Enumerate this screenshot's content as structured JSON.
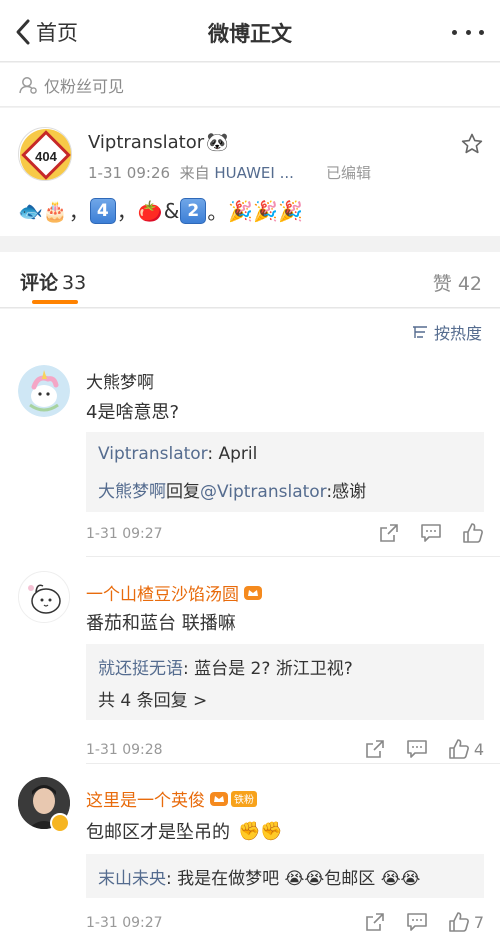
{
  "nav": {
    "back_label": "首页",
    "title": "微博正文"
  },
  "visibility": {
    "label": "仅粉丝可见"
  },
  "post": {
    "author": "Viptranslator",
    "avatar_text": "404",
    "time": "1-31 09:26",
    "source_prefix": "来自",
    "source_device": "HUAWEI ...",
    "edited": "已编辑",
    "content": {
      "emoji1": "🐟🎂",
      "sep1": "，",
      "key1": "4",
      "sep2": "，",
      "emoji2": "🍅",
      "amp": "&",
      "key2": "2",
      "end": "。",
      "emoji3": "🎉🎉🎉"
    }
  },
  "comments_header": {
    "tab_label": "评论",
    "tab_count": "33",
    "likes_label": "赞",
    "likes_count": "42"
  },
  "sort": {
    "label": "按热度"
  },
  "comments": [
    {
      "name": "大熊梦啊",
      "text": "4是啥意思?",
      "reply1_user": "Viptranslator",
      "reply1_text": ": April",
      "reply2_user": "大熊梦啊",
      "reply2_mid": "回复",
      "reply2_mention": "@Viptranslator",
      "reply2_text": ":感谢",
      "time": "1-31 09:27",
      "likes": ""
    },
    {
      "name": "一个山楂豆沙馅汤圆",
      "text": "番茄和蓝台 联播嘛",
      "reply1_user": "就还挺无语",
      "reply1_text": ": 蓝台是 2? 浙江卫视?",
      "more_replies": "共 4 条回复 >",
      "time": "1-31 09:28",
      "likes": "4"
    },
    {
      "name": "这里是一个英俊",
      "fan_badge": "铁粉",
      "text": "包邮区才是坠吊的",
      "text_emoji": "✊✊",
      "reply1_user": "末山未央",
      "reply1_text": ": 我是在做梦吧",
      "reply1_emoji1": "😭😭",
      "reply1_mid": "包邮区",
      "reply1_emoji2": "😭😭",
      "time": "1-31 09:27",
      "likes": "7"
    }
  ],
  "colors": {
    "accent": "#ff8200",
    "link": "#556c8f",
    "name_orange": "#e86b0c"
  }
}
